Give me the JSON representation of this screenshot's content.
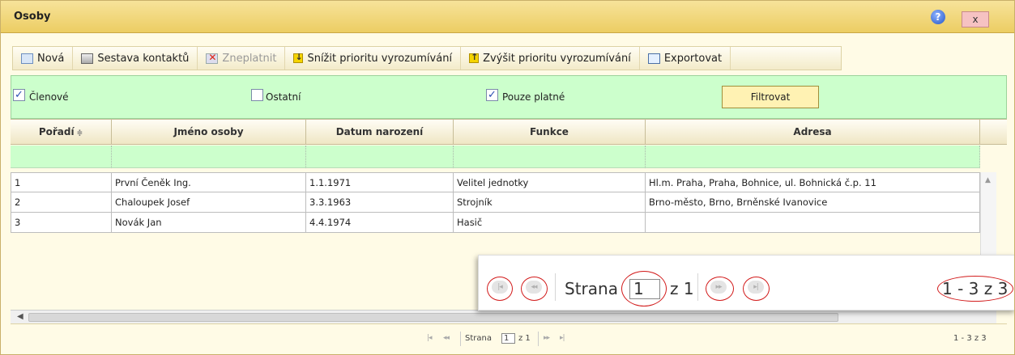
{
  "window": {
    "title": "Osoby",
    "help_icon": "?",
    "close_label": "x"
  },
  "toolbar": {
    "items": [
      {
        "label": "Nová",
        "icon": "new-record-icon",
        "disabled": false
      },
      {
        "label": "Sestava kontaktů",
        "icon": "print-icon",
        "disabled": false
      },
      {
        "label": "Zneplatnit",
        "icon": "invalidate-icon",
        "disabled": true
      },
      {
        "label": "Snížit prioritu vyrozumívání",
        "icon": "arrow-down-icon",
        "disabled": false
      },
      {
        "label": "Zvýšit prioritu vyrozumívání",
        "icon": "arrow-up-icon",
        "disabled": false
      },
      {
        "label": "Exportovat",
        "icon": "export-icon",
        "disabled": false
      }
    ]
  },
  "filters": {
    "members": {
      "label": "Členové",
      "checked": true
    },
    "others": {
      "label": "Ostatní",
      "checked": false
    },
    "valid_only": {
      "label": "Pouze platné",
      "checked": true
    },
    "filter_button": "Filtrovat",
    "check_glyph": "✓"
  },
  "grid": {
    "columns": [
      "Pořadí",
      "Jméno osoby",
      "Datum narození",
      "Funkce",
      "Adresa"
    ],
    "sort_glyph": "≑",
    "rows": [
      [
        "1",
        "První Čeněk Ing.",
        "1.1.1971",
        "Velitel jednotky",
        "Hl.m. Praha, Praha, Bohnice, ul. Bohnická č.p. 11"
      ],
      [
        "2",
        "Chaloupek Josef",
        "3.3.1963",
        "Strojník",
        "Brno-město, Brno, Brněnské Ivanovice"
      ],
      [
        "3",
        "Novák Jan",
        "4.4.1974",
        "Hasič",
        ""
      ]
    ]
  },
  "pager": {
    "page_label": "Strana",
    "page_value": "1",
    "of_label": "z 1",
    "range_text": "1 - 3 z 3",
    "first_glyph": "|◂",
    "prev_glyph": "◂◂",
    "next_glyph": "▸▸",
    "last_glyph": "▸|"
  },
  "zoom": {
    "page_label": "Strana",
    "page_value": "1",
    "of_label": "z 1",
    "range_text": "1 - 3 z 3"
  },
  "colors": {
    "title_bar": "#eccd63",
    "filter_bg": "#ccffcc",
    "highlight_circle": "#d21b1b"
  }
}
